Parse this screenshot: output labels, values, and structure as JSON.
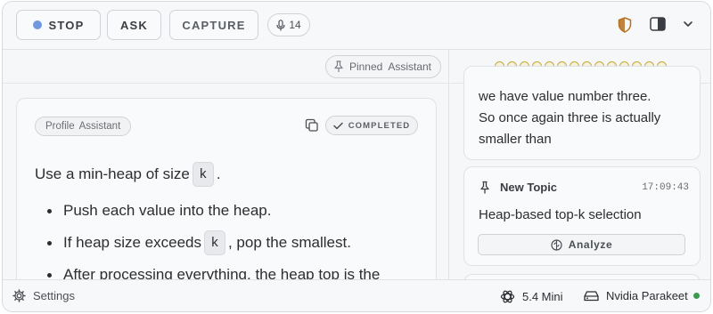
{
  "toolbar": {
    "stop_label": "STOP",
    "ask_label": "ASK",
    "capture_label": "CAPTURE",
    "mic_count": "14",
    "stop_dot_color": "#6f98de"
  },
  "left_pane": {
    "pinned_label": "Pinned",
    "pinned_assistant": "Assistant",
    "card": {
      "profile_label": "Profile",
      "profile_assistant": "Assistant",
      "status": "COMPLETED",
      "intro_text": "Use a min-heap of size",
      "intro_code": "k",
      "intro_suffix": ".",
      "bullets": [
        {
          "text": "Push each value into the heap."
        },
        {
          "before": "If heap size exceeds",
          "code": "k",
          "after": ", pop the smallest."
        },
        {
          "text": "After processing everything, the heap top is the"
        }
      ]
    }
  },
  "right_pane": {
    "progress_dots": 14,
    "transcript_lines": [
      "we have value number three.",
      "So once again three is actually",
      "smaller than"
    ],
    "topic": {
      "label": "New Topic",
      "time": "17:09:43",
      "title": "Heap-based top-k selection",
      "analyze_label": "Analyze"
    }
  },
  "statusbar": {
    "settings_label": "Settings",
    "model_label": "5.4 Mini",
    "stt_label": "Nvidia Parakeet",
    "live_color": "#3c9a4d"
  }
}
